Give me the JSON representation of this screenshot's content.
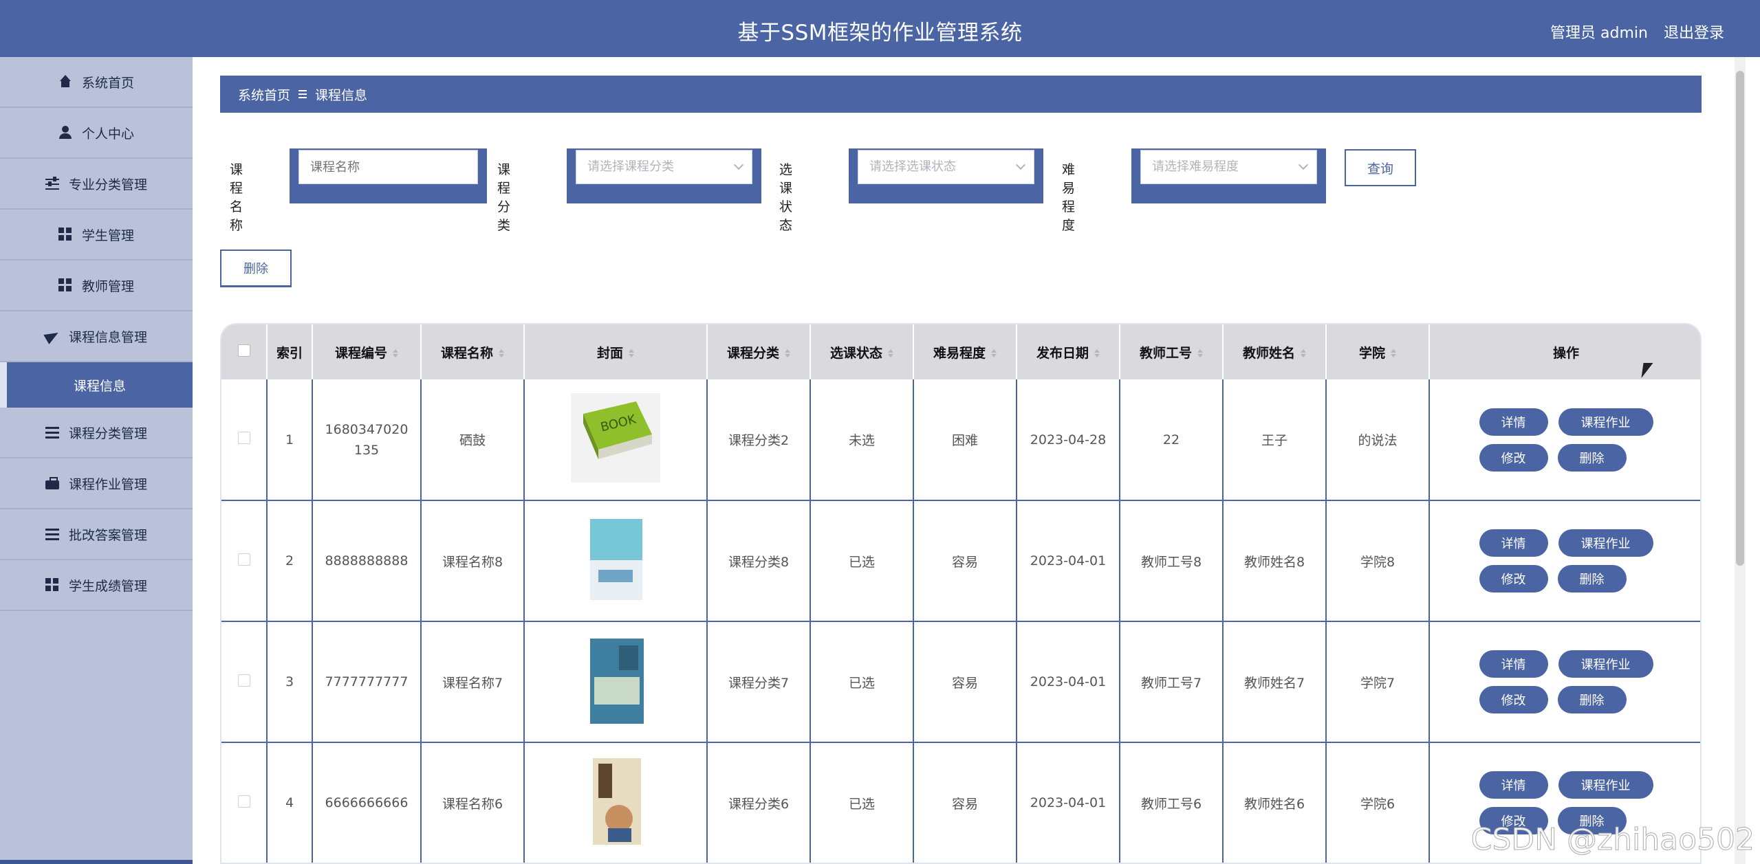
{
  "header": {
    "title": "基于SSM框架的作业管理系统",
    "user_label": "管理员 admin",
    "logout_label": "退出登录"
  },
  "sidebar": {
    "items": [
      {
        "label": "系统首页",
        "icon": "home-icon"
      },
      {
        "label": "个人中心",
        "icon": "user-icon"
      },
      {
        "label": "专业分类管理",
        "icon": "sliders-icon"
      },
      {
        "label": "学生管理",
        "icon": "grid-icon"
      },
      {
        "label": "教师管理",
        "icon": "grid-icon"
      },
      {
        "label": "课程信息管理",
        "icon": "paper-plane-icon"
      },
      {
        "label": "课程信息",
        "icon": "",
        "active": true
      },
      {
        "label": "课程分类管理",
        "icon": "list-icon"
      },
      {
        "label": "课程作业管理",
        "icon": "briefcase-icon"
      },
      {
        "label": "批改答案管理",
        "icon": "list-icon"
      },
      {
        "label": "学生成绩管理",
        "icon": "grid-icon"
      }
    ]
  },
  "breadcrumb": {
    "home": "系统首页",
    "current": "课程信息"
  },
  "search": {
    "course_name_label": "课程名称",
    "course_name_placeholder": "课程名称",
    "category_label": "课程分类",
    "category_placeholder": "请选择课程分类",
    "status_label": "选课状态",
    "status_placeholder": "请选择选课状态",
    "difficulty_label": "难易程度",
    "difficulty_placeholder": "请选择难易程度",
    "query_label": "查询"
  },
  "toolbar": {
    "delete_label": "删除"
  },
  "table": {
    "columns": [
      "索引",
      "课程编号",
      "课程名称",
      "封面",
      "课程分类",
      "选课状态",
      "难易程度",
      "发布日期",
      "教师工号",
      "教师姓名",
      "学院",
      "操作"
    ],
    "actions": {
      "detail": "详情",
      "homework": "课程作业",
      "edit": "修改",
      "delete": "删除"
    },
    "rows": [
      {
        "index": "1",
        "code": "1680347020135",
        "name": "硒鼓",
        "cover": "green-book-cover",
        "category": "课程分类2",
        "status": "未选",
        "difficulty": "困难",
        "date": "2023-04-28",
        "teacher_id": "22",
        "teacher_name": "王子",
        "college": "的说法"
      },
      {
        "index": "2",
        "code": "8888888888",
        "name": "课程名称8",
        "cover": "teal-book-cover",
        "category": "课程分类8",
        "status": "已选",
        "difficulty": "容易",
        "date": "2023-04-01",
        "teacher_id": "教师工号8",
        "teacher_name": "教师姓名8",
        "college": "学院8"
      },
      {
        "index": "3",
        "code": "7777777777",
        "name": "课程名称7",
        "cover": "blue-book-cover",
        "category": "课程分类7",
        "status": "已选",
        "difficulty": "容易",
        "date": "2023-04-01",
        "teacher_id": "教师工号7",
        "teacher_name": "教师姓名7",
        "college": "学院7"
      },
      {
        "index": "4",
        "code": "6666666666",
        "name": "课程名称6",
        "cover": "beige-book-cover",
        "category": "课程分类6",
        "status": "已选",
        "difficulty": "容易",
        "date": "2023-04-01",
        "teacher_id": "教师工号6",
        "teacher_name": "教师姓名6",
        "college": "学院6"
      }
    ]
  },
  "watermark": "CSDN @zhihao502",
  "colors": {
    "primary": "#4a64a4",
    "sidebar": "#b9c2d9",
    "header_cell": "#d9d9de"
  }
}
